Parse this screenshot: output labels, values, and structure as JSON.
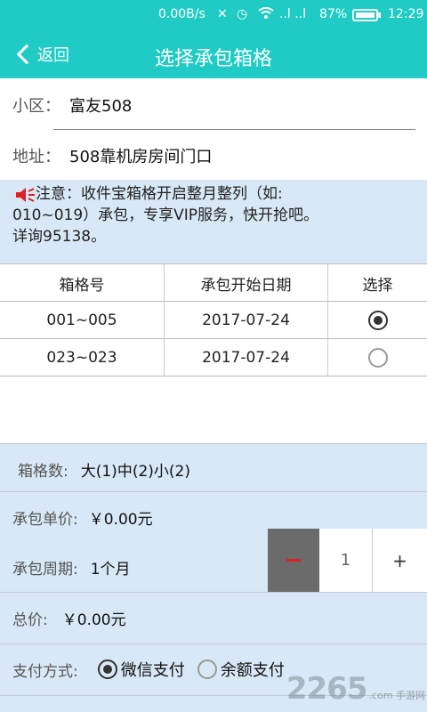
{
  "status_bar": {
    "net_speed": "0.00B/s",
    "signal": "..l ..l",
    "battery": "87%",
    "time": "12:29"
  },
  "header": {
    "back_label": "返回",
    "title": "选择承包箱格"
  },
  "info": {
    "community_label": "小区：",
    "community_value": "富友508",
    "address_label": "地址：",
    "address_value": "508靠机房房间门口"
  },
  "notice": {
    "line1": "注意：收件宝箱格开启整月整列（如:",
    "line2": "010~019）承包，专享VIP服务，快开抢吧。",
    "line3": "详询95138。",
    "accent": "#e02020"
  },
  "table": {
    "headers": [
      "箱格号",
      "承包开始日期",
      "选择"
    ],
    "rows": [
      {
        "box": "001~005",
        "date": "2017-07-24",
        "selected": true
      },
      {
        "box": "023~023",
        "date": "2017-07-24",
        "selected": false
      }
    ]
  },
  "summary": {
    "count_label": "箱格数:",
    "count_value": "大(1)中(2)小(2)",
    "unit_label": "承包单价:",
    "unit_value": "￥0.00元",
    "period_label": "承包周期:",
    "period_value": "1个月",
    "stepper_minus": "−",
    "stepper_value": "1",
    "stepper_plus": "+",
    "total_label": "总价:",
    "total_value": "￥0.00元",
    "pay_label": "支付方式:",
    "pay_options": [
      {
        "label": "微信支付",
        "selected": true
      },
      {
        "label": "余额支付",
        "selected": false
      }
    ]
  },
  "watermark": {
    "brand": "2265",
    "suffix": ".com 手游网"
  },
  "colors": {
    "primary": "#1fcbc4",
    "panel": "#d8e8f6",
    "stepper_minus_bg": "#6b6b6b"
  }
}
